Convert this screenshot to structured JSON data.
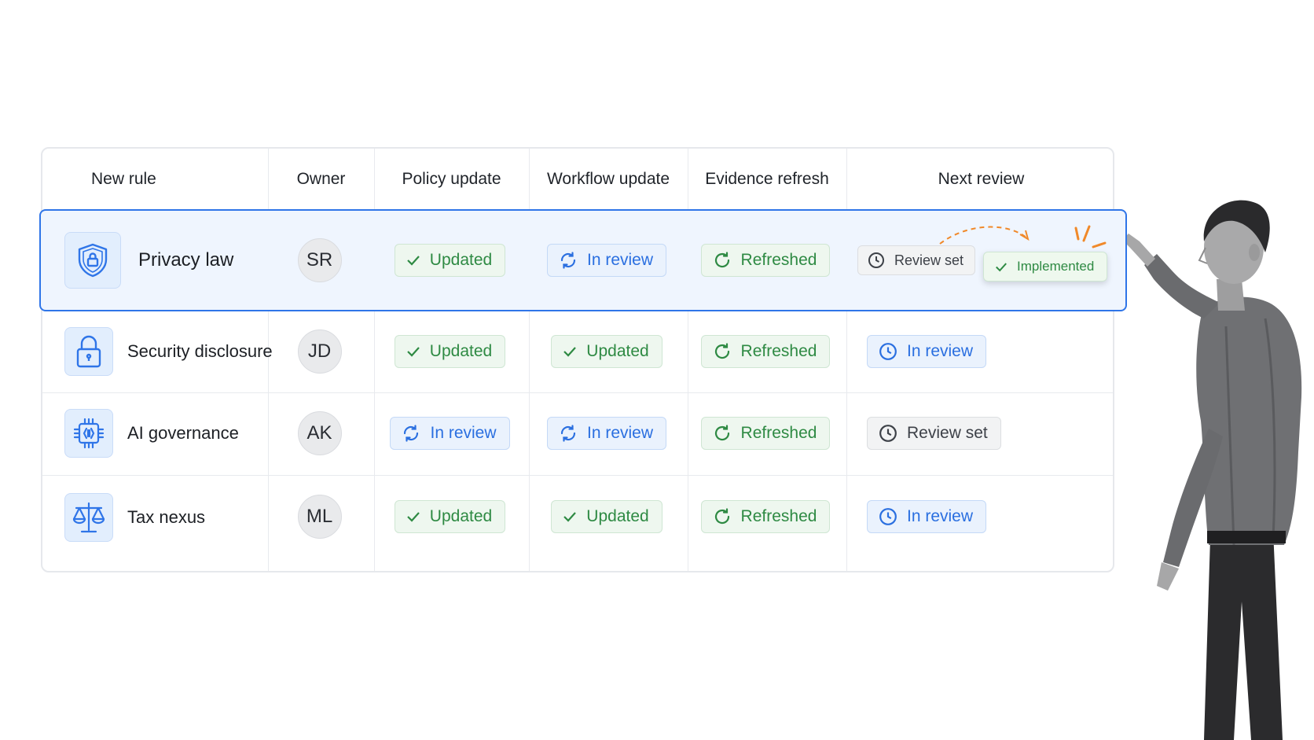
{
  "table": {
    "headers": [
      "New rule",
      "Owner",
      "Policy update",
      "Workflow update",
      "Evidence refresh",
      "Next review"
    ],
    "rows": [
      {
        "icon": "shield-lock-icon",
        "rule": "Privacy law",
        "owner": "SR",
        "policy": "Updated",
        "workflow": "In review",
        "evidence": "Refreshed",
        "next_review": "Review set",
        "next_review_new": "Implemented"
      },
      {
        "icon": "padlock-icon",
        "rule": "Security disclosure",
        "owner": "JD",
        "policy": "Updated",
        "workflow": "Updated",
        "evidence": "Refreshed",
        "next_review": "In review"
      },
      {
        "icon": "chip-icon",
        "rule": "AI governance",
        "owner": "AK",
        "policy": "In review",
        "workflow": "In review",
        "evidence": "Refreshed",
        "next_review": "Review set"
      },
      {
        "icon": "scale-icon",
        "rule": "Tax nexus",
        "owner": "ML",
        "policy": "Updated",
        "workflow": "Updated",
        "evidence": "Refreshed",
        "next_review": "In review"
      }
    ]
  },
  "colors": {
    "accent": "#2f75e8",
    "highlight_bg": "#eff5fe",
    "green": "#2e8a43",
    "blue": "#2a6fe0",
    "arrow": "#f0892a"
  }
}
